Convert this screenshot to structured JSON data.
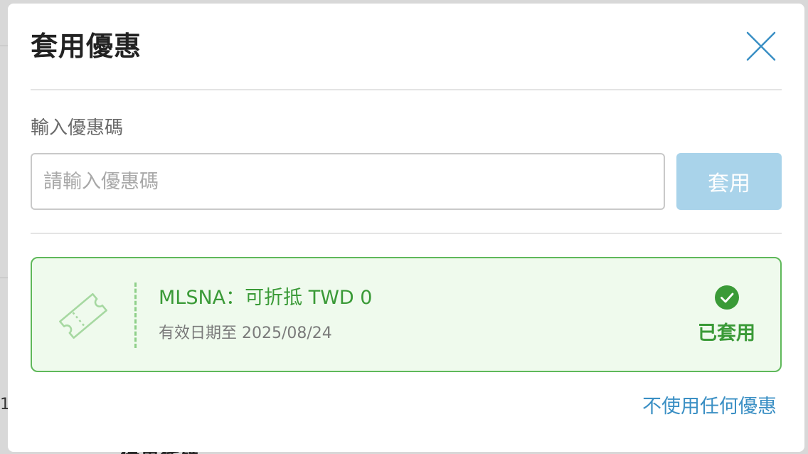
{
  "background": {
    "fragment_left": "1",
    "fragment_bottom": "優惠代碼"
  },
  "modal": {
    "title": "套用優惠",
    "close_icon": "close-icon",
    "input_section": {
      "label": "輸入優惠碼",
      "placeholder": "請輸入優惠碼",
      "value": "",
      "apply_label": "套用"
    },
    "coupons": [
      {
        "icon": "ticket-icon",
        "name": "MLSNA：可折抵 TWD 0",
        "expiry": "有效日期至 2025/08/24",
        "status_icon": "check-circle-icon",
        "status_label": "已套用"
      }
    ],
    "no_coupon_label": "不使用任何優惠"
  },
  "colors": {
    "accent_green": "#3a9a37",
    "card_border": "#5fb85a",
    "card_bg": "#effaed",
    "apply_button_bg": "#a9d3ea",
    "link_blue": "#3a8fc4",
    "close_icon": "#3a8fc4"
  }
}
